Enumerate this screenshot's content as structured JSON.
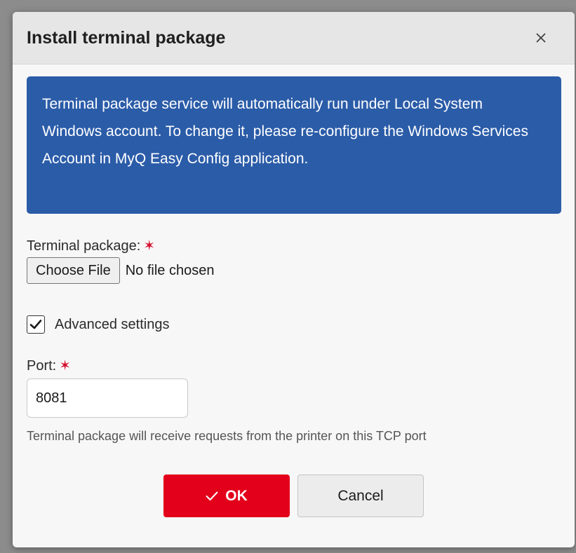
{
  "dialog": {
    "title": "Install terminal package",
    "close_icon": "close-icon"
  },
  "info": {
    "message": "Terminal package service will automatically run under Local System Windows account. To change it, please re-configure the Windows Services Account in MyQ Easy Config application.",
    "background_color": "#2b5ca8"
  },
  "terminal_package": {
    "label": "Terminal package:",
    "required_marker": "✶",
    "choose_file_label": "Choose File",
    "file_status": "No file chosen"
  },
  "advanced_settings": {
    "label": "Advanced settings",
    "checked": true
  },
  "port": {
    "label": "Port:",
    "required_marker": "✶",
    "value": "8081",
    "help": "Terminal package will receive requests from the printer on this TCP port"
  },
  "actions": {
    "ok_label": "OK",
    "ok_icon": "check-icon",
    "ok_color": "#e3001b",
    "cancel_label": "Cancel"
  }
}
